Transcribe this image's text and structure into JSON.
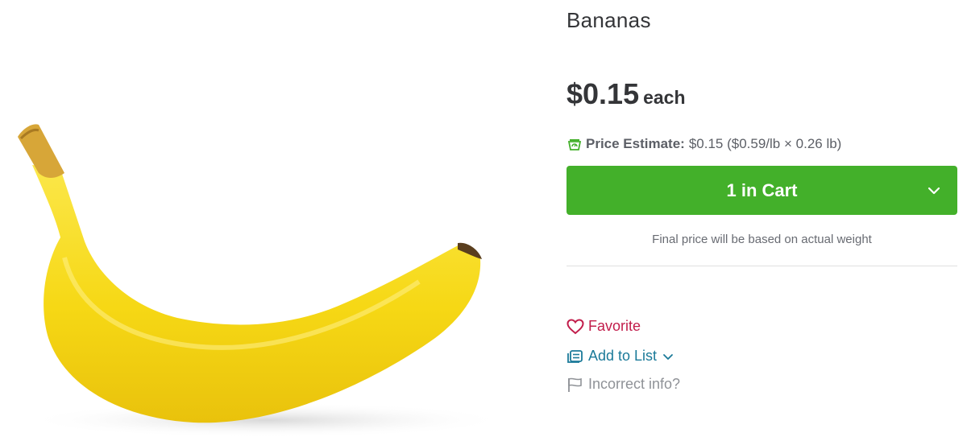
{
  "product": {
    "title": "Bananas",
    "price": "$0.15",
    "price_unit": "each",
    "estimate_label": "Price Estimate:",
    "estimate_value": "$0.15 ($0.59/lb × 0.26 lb)",
    "cart_label": "1 in Cart",
    "weight_note": "Final price will be based on actual weight"
  },
  "actions": {
    "favorite": "Favorite",
    "add_to_list": "Add to List",
    "incorrect_info": "Incorrect info?"
  },
  "colors": {
    "cart_green": "#43b02a",
    "favorite_red": "#c21d4b",
    "list_teal": "#1b7a99",
    "muted_gray": "#8f9297"
  },
  "icons": {
    "estimate": "scale-icon",
    "cart_dropdown": "chevron-down-icon",
    "favorite": "heart-icon",
    "add_to_list": "list-icon",
    "incorrect_info": "flag-icon"
  }
}
